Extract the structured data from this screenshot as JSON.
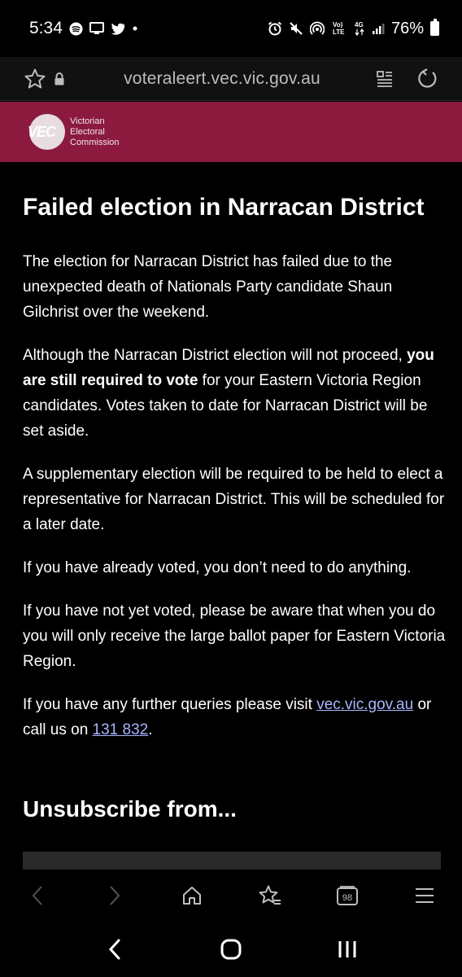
{
  "status_bar": {
    "time": "5:34",
    "battery": "76%",
    "network": "4G",
    "volte": "Vo) LTE"
  },
  "browser": {
    "url": "voteraleert.vec.vic.gov.au"
  },
  "banner": {
    "logo_text": "VEC",
    "org_line1": "Victorian",
    "org_line2": "Electoral",
    "org_line3": "Commission",
    "color": "#8b1a3e"
  },
  "article": {
    "title": "Failed election in Narracan District",
    "p1": "The election for Narracan District has failed due to the unexpected death of Nationals Party candidate Shaun Gilchrist over the weekend.",
    "p2_a": "Although the Narracan District election will not proceed, ",
    "p2_bold": "you are still required to vote",
    "p2_b": " for your Eastern Victoria Region candidates. Votes taken to date for Narracan District will be set aside.",
    "p3": "A supplementary election will be required to be held to elect a representative for Narracan District. This will be scheduled for a later date.",
    "p4": "If you have already voted, you don’t need to do anything.",
    "p5": "If you have not yet voted, please be aware that when you do you will only receive the large ballot paper for Eastern Victoria Region.",
    "p6_a": "If you have any further queries please visit ",
    "p6_link": "vec.vic.gov.au",
    "p6_b": " or call us on ",
    "p6_phone": "131 832",
    "p6_c": ".",
    "unsubscribe_title": "Unsubscribe from..."
  },
  "toolbar": {
    "tab_count": "98",
    "icons": [
      "back-icon",
      "forward-icon",
      "home-icon",
      "bookmarks-icon",
      "tabs-icon",
      "menu-icon"
    ]
  },
  "navbar": {
    "icons": [
      "nav-back-icon",
      "nav-home-icon",
      "nav-recents-icon"
    ]
  }
}
